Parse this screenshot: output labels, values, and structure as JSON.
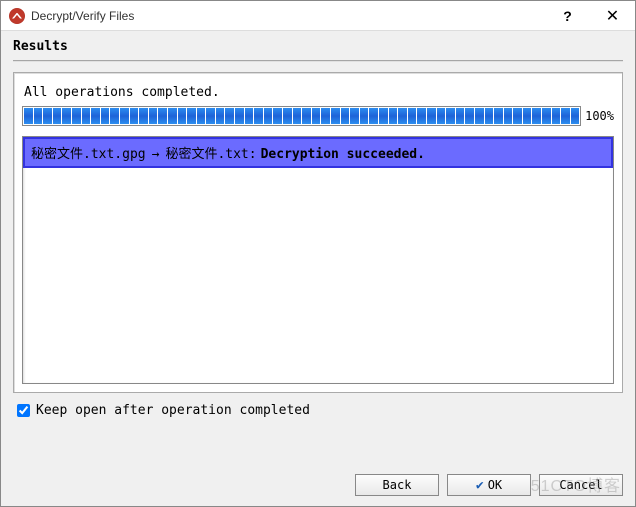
{
  "window": {
    "title": "Decrypt/Verify Files"
  },
  "section": {
    "heading": "Results"
  },
  "status": {
    "message": "All operations completed.",
    "progress_pct": "100%"
  },
  "result": {
    "source_file": "秘密文件.txt.gpg",
    "arrow": "→",
    "target_file": "秘密文件.txt:",
    "status_text": "Decryption succeeded."
  },
  "options": {
    "keep_open_label": "Keep open after operation completed",
    "keep_open_checked": true
  },
  "buttons": {
    "back": "Back",
    "ok": "OK",
    "cancel": "Cancel"
  },
  "watermark": "51CTO博客"
}
